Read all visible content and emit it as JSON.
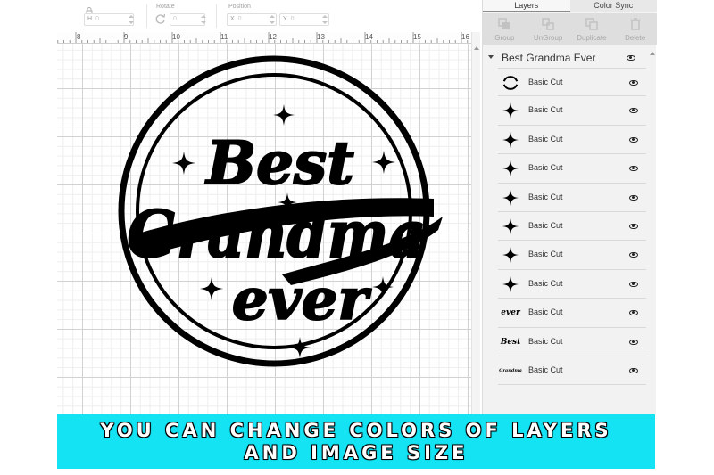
{
  "toolbar": {
    "height_label": "H",
    "height_value": "0",
    "rotate_label": "Rotate",
    "rotate_value": "0",
    "position_label": "Position",
    "x_label": "X",
    "x_value": "0",
    "y_label": "Y",
    "y_value": "0"
  },
  "ruler": {
    "ticks": [
      "8",
      "9",
      "10",
      "11",
      "12",
      "13",
      "14",
      "15",
      "16"
    ]
  },
  "artwork": {
    "line1": "Best",
    "line2": "Grandma",
    "line3": "ever"
  },
  "panel": {
    "tabs": [
      {
        "label": "Layers",
        "active": true
      },
      {
        "label": "Color Sync",
        "active": false
      }
    ],
    "actions": [
      {
        "label": "Group",
        "icon": "group-icon"
      },
      {
        "label": "UnGroup",
        "icon": "ungroup-icon"
      },
      {
        "label": "Duplicate",
        "icon": "duplicate-icon"
      },
      {
        "label": "Delete",
        "icon": "trash-icon"
      }
    ],
    "group_title": "Best Grandma Ever",
    "layers": [
      {
        "label": "Basic Cut",
        "thumb": "ring-icon"
      },
      {
        "label": "Basic Cut",
        "thumb": "sparkle-icon"
      },
      {
        "label": "Basic Cut",
        "thumb": "sparkle-icon"
      },
      {
        "label": "Basic Cut",
        "thumb": "sparkle-icon"
      },
      {
        "label": "Basic Cut",
        "thumb": "sparkle-icon"
      },
      {
        "label": "Basic Cut",
        "thumb": "sparkle-icon"
      },
      {
        "label": "Basic Cut",
        "thumb": "sparkle-icon"
      },
      {
        "label": "Basic Cut",
        "thumb": "sparkle-icon"
      },
      {
        "label": "Basic Cut",
        "thumb": "text",
        "thumb_text": "ever"
      },
      {
        "label": "Basic Cut",
        "thumb": "text",
        "thumb_text": "Best"
      },
      {
        "label": "Basic Cut",
        "thumb": "text",
        "thumb_text": "Grandma"
      }
    ]
  },
  "banner": {
    "line1": "YOU CAN CHANGE COLORS OF LAYERS",
    "line2": "AND IMAGE SIZE"
  },
  "colors": {
    "banner": "#13e3f3",
    "panel": "#f2f2f2",
    "grid": "#d2d2d2"
  }
}
